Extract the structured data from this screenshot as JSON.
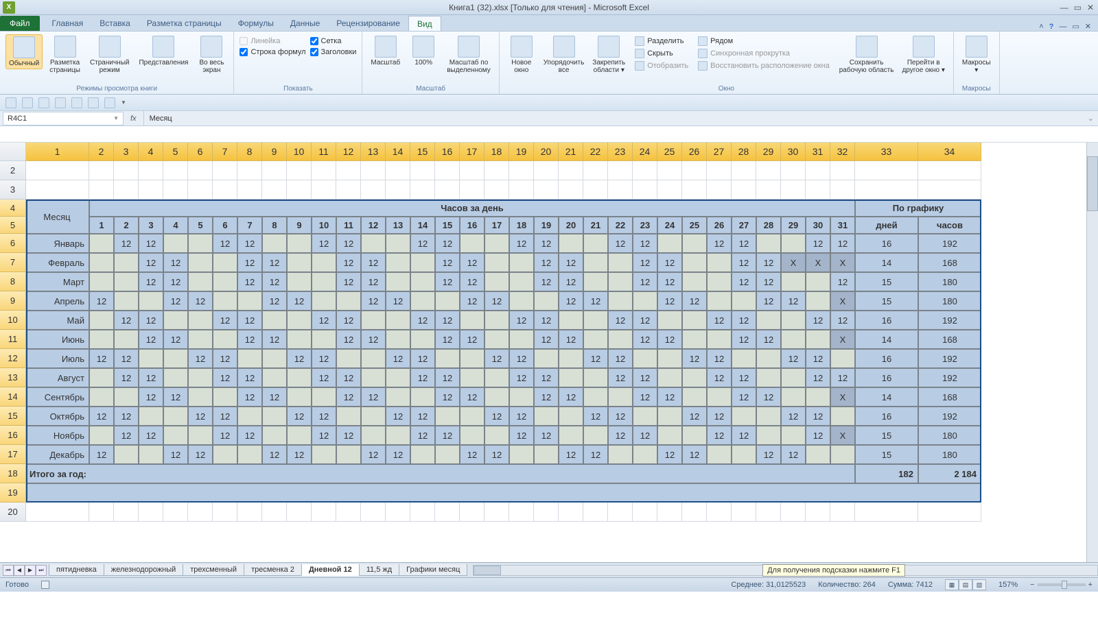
{
  "title": "Книга1 (32).xlsx  [Только для чтения]  -  Microsoft Excel",
  "file_tab": "Файл",
  "tabs": [
    "Главная",
    "Вставка",
    "Разметка страницы",
    "Формулы",
    "Данные",
    "Рецензирование",
    "Вид"
  ],
  "active_tab": 6,
  "ribbon": {
    "g1": {
      "label": "Режимы просмотра книги",
      "btns": [
        "Обычный",
        "Разметка\nстраницы",
        "Страничный\nрежим",
        "Представления",
        "Во весь\nэкран"
      ]
    },
    "g2": {
      "label": "Показать",
      "chk": [
        {
          "l": "Линейка",
          "c": false,
          "d": true
        },
        {
          "l": "Строка формул",
          "c": true
        },
        {
          "l": "Сетка",
          "c": true
        },
        {
          "l": "Заголовки",
          "c": true
        }
      ]
    },
    "g3": {
      "label": "Масштаб",
      "btns": [
        "Масштаб",
        "100%",
        "Масштаб по\nвыделенному"
      ]
    },
    "g4": {
      "label": "Окно",
      "big": [
        "Новое\nокно",
        "Упорядочить\nвсе",
        "Закрепить\nобласти ▾"
      ],
      "small": [
        {
          "l": "Разделить"
        },
        {
          "l": "Скрыть"
        },
        {
          "l": "Отобразить",
          "d": true
        }
      ],
      "small2": [
        {
          "l": "Рядом"
        },
        {
          "l": "Синхронная прокрутка",
          "d": true
        },
        {
          "l": "Восстановить расположение окна",
          "d": true
        }
      ],
      "big2": [
        "Сохранить\nрабочую область",
        "Перейти в\nдругое окно ▾"
      ]
    },
    "g5": {
      "label": "Макросы",
      "btns": [
        "Макросы\n▾"
      ]
    }
  },
  "namebox": "R4C1",
  "fx": "fx",
  "formula": "Месяц",
  "col_headers_sel_from": 1,
  "col_headers_sel_to": 34,
  "row_headers": [
    2,
    3,
    4,
    5,
    6,
    7,
    8,
    9,
    10,
    11,
    12,
    13,
    14,
    15,
    16,
    17,
    18,
    19,
    20
  ],
  "row_sel_from": 4,
  "row_sel_to": 19,
  "table": {
    "month_hdr": "Месяц",
    "hours_hdr": "Часов за день",
    "schedule_hdr": "По графику",
    "day_cols": [
      "1",
      "2",
      "3",
      "4",
      "5",
      "6",
      "7",
      "8",
      "9",
      "10",
      "11",
      "12",
      "13",
      "14",
      "15",
      "16",
      "17",
      "18",
      "19",
      "20",
      "21",
      "22",
      "23",
      "24",
      "25",
      "26",
      "27",
      "28",
      "29",
      "30",
      "31"
    ],
    "sum_cols": [
      "дней",
      "часов"
    ],
    "months": [
      "Январь",
      "Февраль",
      "Март",
      "Апрель",
      "Май",
      "Июнь",
      "Июль",
      "Август",
      "Сентябрь",
      "Октябрь",
      "Ноябрь",
      "Декабрь"
    ],
    "data": [
      [
        "",
        "12",
        "12",
        "",
        "",
        "12",
        "12",
        "",
        "",
        "12",
        "12",
        "",
        "",
        "12",
        "12",
        "",
        "",
        "12",
        "12",
        "",
        "",
        "12",
        "12",
        "",
        "",
        "12",
        "12",
        "",
        "",
        "12",
        "12",
        "16",
        "192"
      ],
      [
        "",
        "",
        "12",
        "12",
        "",
        "",
        "12",
        "12",
        "",
        "",
        "12",
        "12",
        "",
        "",
        "12",
        "12",
        "",
        "",
        "12",
        "12",
        "",
        "",
        "12",
        "12",
        "",
        "",
        "12",
        "12",
        "X",
        "X",
        "X",
        "14",
        "168"
      ],
      [
        "",
        "",
        "12",
        "12",
        "",
        "",
        "12",
        "12",
        "",
        "",
        "12",
        "12",
        "",
        "",
        "12",
        "12",
        "",
        "",
        "12",
        "12",
        "",
        "",
        "12",
        "12",
        "",
        "",
        "12",
        "12",
        "",
        "",
        "12",
        "15",
        "180"
      ],
      [
        "12",
        "",
        "",
        "12",
        "12",
        "",
        "",
        "12",
        "12",
        "",
        "",
        "12",
        "12",
        "",
        "",
        "12",
        "12",
        "",
        "",
        "12",
        "12",
        "",
        "",
        "12",
        "12",
        "",
        "",
        "12",
        "12",
        "",
        "X",
        "15",
        "180"
      ],
      [
        "",
        "12",
        "12",
        "",
        "",
        "12",
        "12",
        "",
        "",
        "12",
        "12",
        "",
        "",
        "12",
        "12",
        "",
        "",
        "12",
        "12",
        "",
        "",
        "12",
        "12",
        "",
        "",
        "12",
        "12",
        "",
        "",
        "12",
        "12",
        "16",
        "192"
      ],
      [
        "",
        "",
        "12",
        "12",
        "",
        "",
        "12",
        "12",
        "",
        "",
        "12",
        "12",
        "",
        "",
        "12",
        "12",
        "",
        "",
        "12",
        "12",
        "",
        "",
        "12",
        "12",
        "",
        "",
        "12",
        "12",
        "",
        "",
        "X",
        "14",
        "168"
      ],
      [
        "12",
        "12",
        "",
        "",
        "12",
        "12",
        "",
        "",
        "12",
        "12",
        "",
        "",
        "12",
        "12",
        "",
        "",
        "12",
        "12",
        "",
        "",
        "12",
        "12",
        "",
        "",
        "12",
        "12",
        "",
        "",
        "12",
        "12",
        "",
        "16",
        "192"
      ],
      [
        "",
        "12",
        "12",
        "",
        "",
        "12",
        "12",
        "",
        "",
        "12",
        "12",
        "",
        "",
        "12",
        "12",
        "",
        "",
        "12",
        "12",
        "",
        "",
        "12",
        "12",
        "",
        "",
        "12",
        "12",
        "",
        "",
        "12",
        "12",
        "16",
        "192"
      ],
      [
        "",
        "",
        "12",
        "12",
        "",
        "",
        "12",
        "12",
        "",
        "",
        "12",
        "12",
        "",
        "",
        "12",
        "12",
        "",
        "",
        "12",
        "12",
        "",
        "",
        "12",
        "12",
        "",
        "",
        "12",
        "12",
        "",
        "",
        "X",
        "14",
        "168"
      ],
      [
        "12",
        "12",
        "",
        "",
        "12",
        "12",
        "",
        "",
        "12",
        "12",
        "",
        "",
        "12",
        "12",
        "",
        "",
        "12",
        "12",
        "",
        "",
        "12",
        "12",
        "",
        "",
        "12",
        "12",
        "",
        "",
        "12",
        "12",
        "",
        "16",
        "192"
      ],
      [
        "",
        "12",
        "12",
        "",
        "",
        "12",
        "12",
        "",
        "",
        "12",
        "12",
        "",
        "",
        "12",
        "12",
        "",
        "",
        "12",
        "12",
        "",
        "",
        "12",
        "12",
        "",
        "",
        "12",
        "12",
        "",
        "",
        "12",
        "X",
        "15",
        "180"
      ],
      [
        "12",
        "",
        "",
        "12",
        "12",
        "",
        "",
        "12",
        "12",
        "",
        "",
        "12",
        "12",
        "",
        "",
        "12",
        "12",
        "",
        "",
        "12",
        "12",
        "",
        "",
        "12",
        "12",
        "",
        "",
        "12",
        "12",
        "",
        "",
        "15",
        "180"
      ]
    ],
    "total_label": "Итого за год:",
    "total_days": "182",
    "total_hours": "2 184"
  },
  "sheet_tabs": [
    "пятидневка",
    "железнодорожный",
    "трехсменный",
    "тресменка 2",
    "Дневной 12",
    "11,5 жд",
    "Графики месяц"
  ],
  "active_sheet": 4,
  "tooltip": "Для получения подсказки нажмите F1",
  "status": {
    "ready": "Готово",
    "avg": "Среднее: 31,0125523",
    "count": "Количество: 264",
    "sum": "Сумма: 7412",
    "zoom": "157%"
  }
}
